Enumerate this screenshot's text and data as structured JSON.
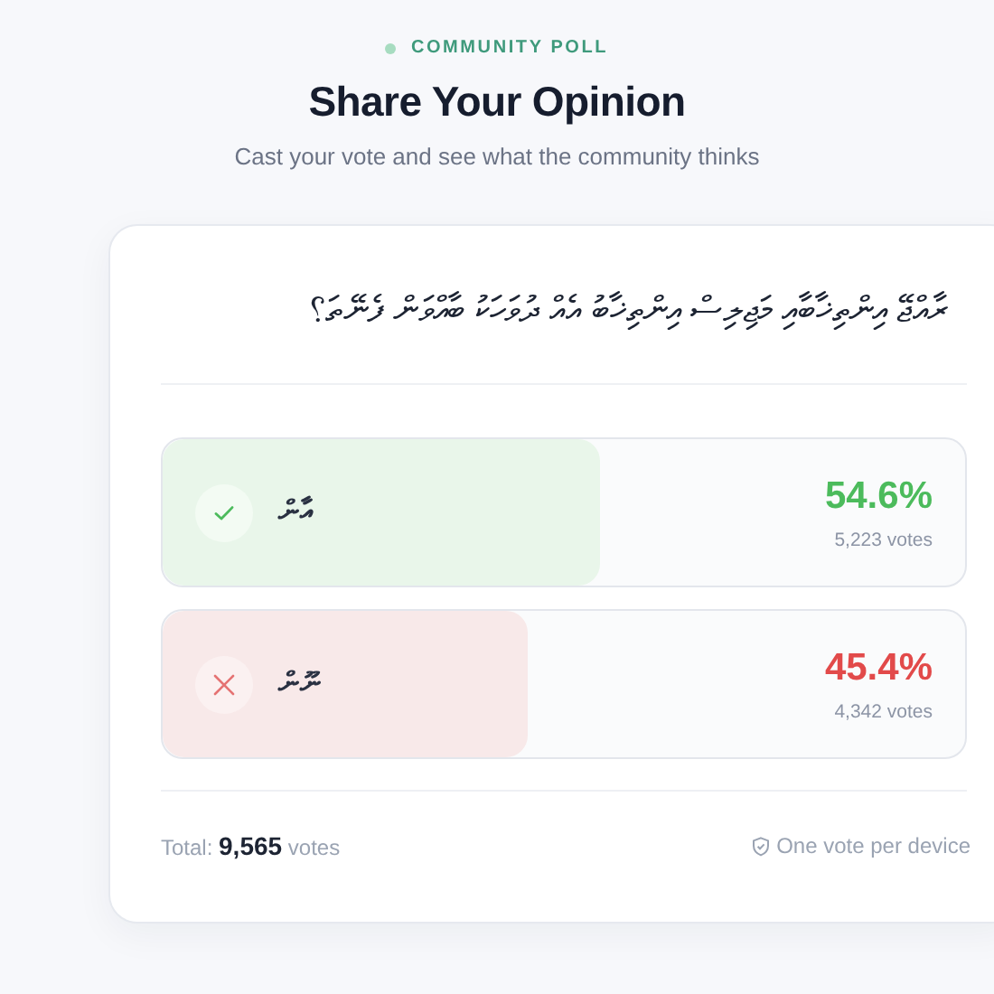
{
  "eyebrow": "COMMUNITY POLL",
  "title": "Share Your Opinion",
  "subtitle": "Cast your vote and see what the community thinks",
  "question": "ރާއްޖޭ އިންތިޚާބާއި މަޖިލިސް އިންތިޚާބު އެއް ދުވަހަކު ބާއްވަން ފެނޭތަ؟",
  "options": [
    {
      "kind": "yes",
      "label": "އާން",
      "percent": "54.6%",
      "votes": "5,223 votes",
      "level": 0.546
    },
    {
      "kind": "no",
      "label": "ނޫން",
      "percent": "45.4%",
      "votes": "4,342 votes",
      "level": 0.454
    }
  ],
  "footer": {
    "total_label": "Total:",
    "total": "9,565",
    "total_unit": "votes",
    "note": "One vote per device"
  }
}
